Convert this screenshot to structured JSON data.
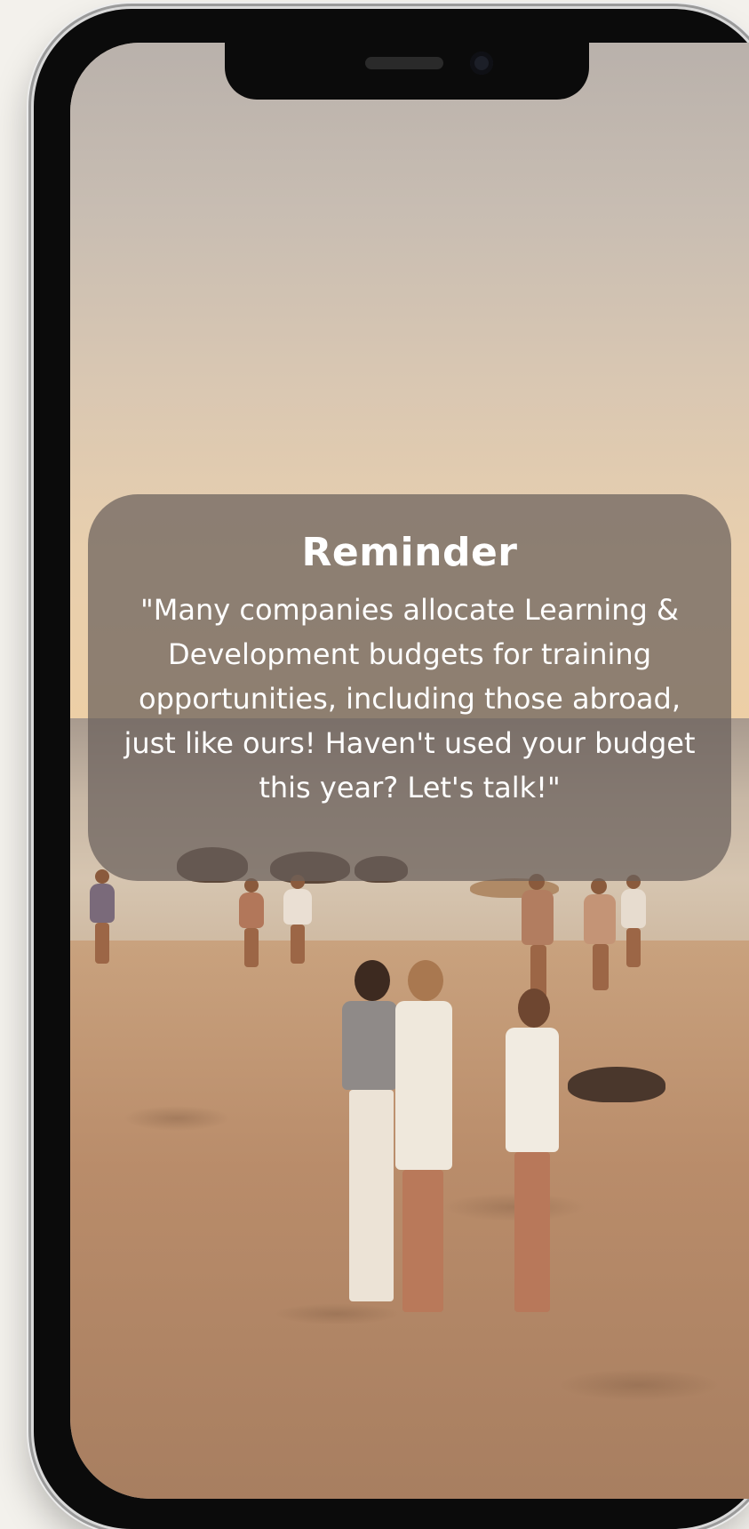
{
  "reminder": {
    "title": "Reminder",
    "message": "\"Many companies allocate Learning & Development budgets for training opportunities, including those abroad, just like ours! Haven't used your budget this year? Let's talk!\""
  },
  "background_image": {
    "icon": "beach-sunset-photo"
  },
  "colors": {
    "card_background": "#69605c",
    "text": "#ffffff",
    "phone_frame": "#0b0b0b",
    "page_background": "#f3f1ec"
  }
}
